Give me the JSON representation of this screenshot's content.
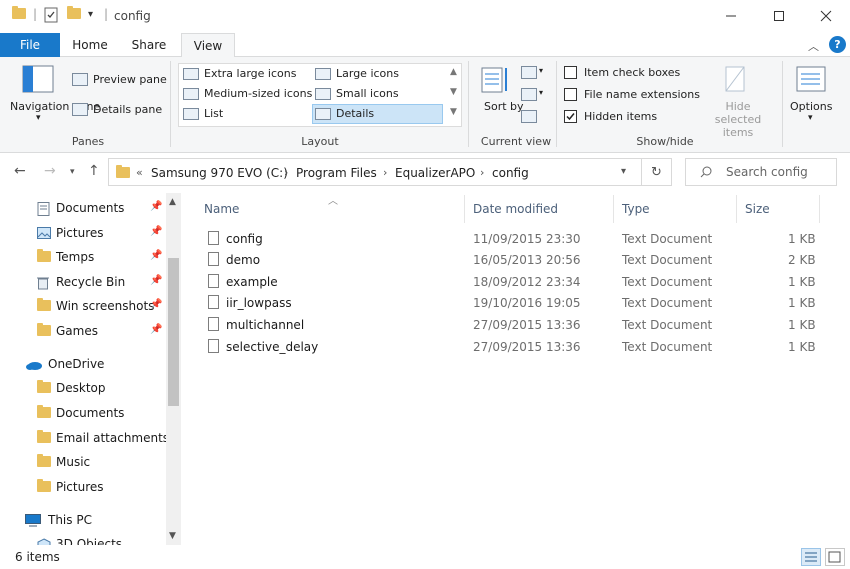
{
  "window": {
    "title": "config",
    "minimize_icon": "minimize-icon",
    "maximize_icon": "maximize-icon",
    "close_icon": "close-icon"
  },
  "ribbon_tabs": [
    "File",
    "Home",
    "Share",
    "View"
  ],
  "ribbon": {
    "panes": {
      "navigation_pane_label": "Navigation pane",
      "preview_pane_label": "Preview pane",
      "details_pane_label": "Details pane",
      "group_label": "Panes"
    },
    "layout": {
      "extra_large_icons": "Extra large icons",
      "large_icons": "Large icons",
      "medium_icons": "Medium-sized icons",
      "small_icons": "Small icons",
      "list": "List",
      "details": "Details",
      "selected": "Details",
      "group_label": "Layout"
    },
    "current_view": {
      "sort_by": "Sort by",
      "group_label": "Current view"
    },
    "show_hide": {
      "item_check_boxes": "Item check boxes",
      "item_check_boxes_checked": false,
      "file_name_extensions": "File name extensions",
      "file_name_extensions_checked": false,
      "hidden_items": "Hidden items",
      "hidden_items_checked": true,
      "hide_selected_items": "Hide selected items",
      "group_label": "Show/hide"
    },
    "options_label": "Options"
  },
  "address": {
    "overflow": "«",
    "breadcrumb": [
      "Samsung 970 EVO (C:)",
      "Program Files",
      "EqualizerAPO",
      "config"
    ],
    "search_placeholder": "Search config"
  },
  "nav_pane": {
    "quick_access": [
      {
        "label": "Documents",
        "icon": "documents-icon",
        "pinned": true
      },
      {
        "label": "Pictures",
        "icon": "pictures-icon",
        "pinned": true
      },
      {
        "label": "Temps",
        "icon": "folder-icon",
        "pinned": true
      },
      {
        "label": "Recycle Bin",
        "icon": "recycle-bin-icon",
        "pinned": true
      },
      {
        "label": "Win screenshots",
        "icon": "folder-icon",
        "pinned": true
      },
      {
        "label": "Games",
        "icon": "folder-icon",
        "pinned": true
      }
    ],
    "onedrive": {
      "label": "OneDrive",
      "items": [
        "Desktop",
        "Documents",
        "Email attachments",
        "Music",
        "Pictures"
      ]
    },
    "this_pc": {
      "label": "This PC",
      "items": [
        "3D Objects"
      ]
    }
  },
  "file_list": {
    "columns": [
      "Name",
      "Date modified",
      "Type",
      "Size"
    ],
    "rows": [
      {
        "name": "config",
        "date": "11/09/2015 23:30",
        "type": "Text Document",
        "size": "1 KB"
      },
      {
        "name": "demo",
        "date": "16/05/2013 20:56",
        "type": "Text Document",
        "size": "2 KB"
      },
      {
        "name": "example",
        "date": "18/09/2012 23:34",
        "type": "Text Document",
        "size": "1 KB"
      },
      {
        "name": "iir_lowpass",
        "date": "19/10/2016 19:05",
        "type": "Text Document",
        "size": "1 KB"
      },
      {
        "name": "multichannel",
        "date": "27/09/2015 13:36",
        "type": "Text Document",
        "size": "1 KB"
      },
      {
        "name": "selective_delay",
        "date": "27/09/2015 13:36",
        "type": "Text Document",
        "size": "1 KB"
      }
    ]
  },
  "status": {
    "item_count": "6 items"
  },
  "colors": {
    "accent": "#1979ca",
    "folder": "#e9c05c",
    "selection": "#cce4f7"
  }
}
